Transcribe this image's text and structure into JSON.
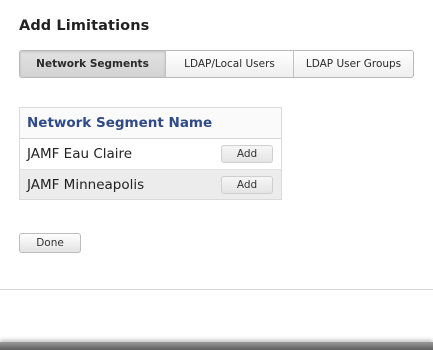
{
  "dialog": {
    "title": "Add Limitations"
  },
  "tabs": [
    {
      "label": "Network Segments",
      "active": true
    },
    {
      "label": "LDAP/Local Users",
      "active": false
    },
    {
      "label": "LDAP User Groups",
      "active": false
    }
  ],
  "table": {
    "header": "Network Segment Name",
    "rows": [
      {
        "name": "JAMF Eau Claire",
        "action": "Add"
      },
      {
        "name": "JAMF Minneapolis",
        "action": "Add"
      }
    ]
  },
  "footer": {
    "done_label": "Done"
  }
}
